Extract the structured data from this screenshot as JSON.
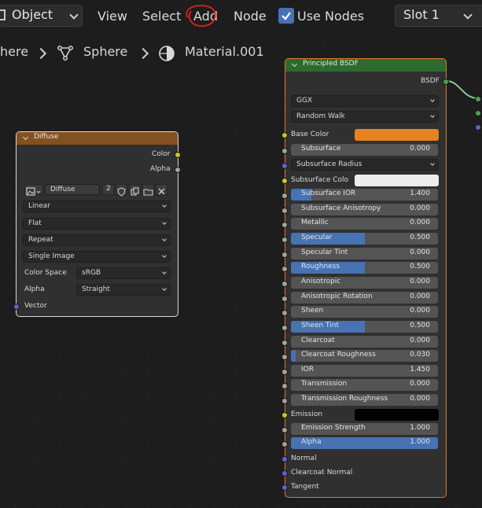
{
  "header": {
    "mode": "Object",
    "menu": [
      "View",
      "Select",
      "Add",
      "Node"
    ],
    "use_nodes_label": "Use Nodes",
    "use_nodes_checked": true,
    "slot": "Slot 1"
  },
  "breadcrumb": {
    "object": "here",
    "mesh": "Sphere",
    "material": "Material.001"
  },
  "diffuse_node": {
    "title": "Diffuse",
    "outputs": [
      "Color",
      "Alpha"
    ],
    "image_name": "Diffuse",
    "users": "2",
    "interpolation": "Linear",
    "projection": "Flat",
    "extension": "Repeat",
    "source": "Single Image",
    "color_space_label": "Color Space",
    "color_space": "sRGB",
    "alpha_label": "Alpha",
    "alpha_mode": "Straight",
    "vector_label": "Vector"
  },
  "bsdf_node": {
    "title": "Principled BSDF",
    "output": "BSDF",
    "distribution": "GGX",
    "subsurface_method": "Random Walk",
    "base_color_label": "Base Color",
    "base_color": "#e5831f",
    "subsurface_radius_label": "Subsurface Radius",
    "subsurface_color_label": "Subsurface Colo",
    "subsurface_color": "#ececec",
    "emission_label": "Emission",
    "emission_color": "#000000",
    "normal_label": "Normal",
    "clearcoat_normal_label": "Clearcoat Normal",
    "tangent_label": "Tangent",
    "params_a": [
      {
        "name": "Subsurface",
        "value": "0.000",
        "fill": 0
      }
    ],
    "params_b": [
      {
        "name": "Subsurface IOR",
        "value": "1.400",
        "fill": 0.14
      },
      {
        "name": "Subsurface Anisotropy",
        "value": "0.000",
        "fill": 0
      },
      {
        "name": "Metallic",
        "value": "0.000",
        "fill": 0
      },
      {
        "name": "Specular",
        "value": "0.500",
        "fill": 0.5
      },
      {
        "name": "Specular Tint",
        "value": "0.000",
        "fill": 0
      },
      {
        "name": "Roughness",
        "value": "0.500",
        "fill": 0.5
      },
      {
        "name": "Anisotropic",
        "value": "0.000",
        "fill": 0
      },
      {
        "name": "Anisotropic Rotation",
        "value": "0.000",
        "fill": 0
      },
      {
        "name": "Sheen",
        "value": "0.000",
        "fill": 0
      },
      {
        "name": "Sheen Tint",
        "value": "0.500",
        "fill": 0.5
      },
      {
        "name": "Clearcoat",
        "value": "0.000",
        "fill": 0
      },
      {
        "name": "Clearcoat Roughness",
        "value": "0.030",
        "fill": 0.03
      },
      {
        "name": "IOR",
        "value": "1.450",
        "fill": 0
      },
      {
        "name": "Transmission",
        "value": "0.000",
        "fill": 0
      },
      {
        "name": "Transmission Roughness",
        "value": "0.000",
        "fill": 0
      }
    ],
    "params_c": [
      {
        "name": "Emission Strength",
        "value": "1.000",
        "fill": 0
      },
      {
        "name": "Alpha",
        "value": "1.000",
        "fill": 1
      }
    ]
  },
  "colors": {
    "accent": "#4772b3",
    "diffuse_header": "#83501f",
    "bsdf_header": "#2d6a2d",
    "node_selected_border": "#e3792a",
    "socket_color": "#c7c729",
    "socket_float": "#a1a1a1",
    "socket_vector": "#6363c7",
    "annotation": "#d42020"
  }
}
